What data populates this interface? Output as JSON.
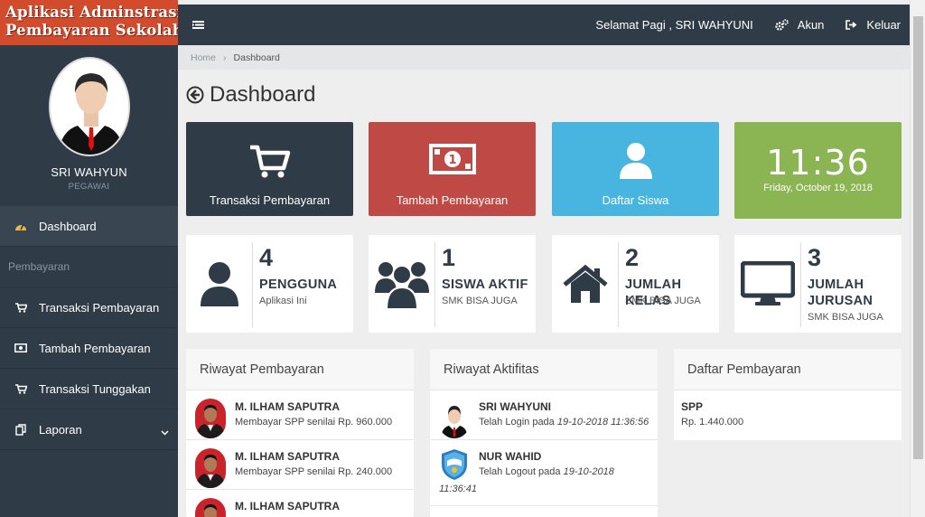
{
  "brand": {
    "line1": "Aplikasi Adminstrasi",
    "line2": "Pembayaran Sekolah"
  },
  "profile": {
    "name": "SRI WAHYUN",
    "role": "PEGAWAI"
  },
  "sidebar": {
    "dashboard": "Dashboard",
    "section": "Pembayaran",
    "items": [
      {
        "label": "Transaksi Pembayaran",
        "icon": "cart-icon"
      },
      {
        "label": "Tambah Pembayaran",
        "icon": "money-icon"
      },
      {
        "label": "Transaksi Tunggakan",
        "icon": "cart-icon"
      },
      {
        "label": "Laporan",
        "icon": "copy-icon"
      }
    ]
  },
  "topbar": {
    "greeting": "Selamat Pagi , SRI WAHYUNI",
    "account": "Akun",
    "logout": "Keluar"
  },
  "breadcrumb": {
    "home": "Home",
    "current": "Dashboard"
  },
  "page_title": "Dashboard",
  "tiles": {
    "t1": "Transaksi Pembayaran",
    "t2": "Tambah Pembayaran",
    "t3": "Daftar Siswa",
    "clock_time": "11:36",
    "clock_date": "Friday, October 19, 2018"
  },
  "stats": [
    {
      "num": "4",
      "title": "PENGGUNA",
      "sub": "Aplikasi Ini"
    },
    {
      "num": "1",
      "title": "SISWA AKTIF",
      "sub": "SMK BISA JUGA"
    },
    {
      "num": "2",
      "title": "JUMLAH KELAS",
      "sub": "SMK BISA JUGA"
    },
    {
      "num": "3",
      "title": "JUMLAH JURUSAN",
      "sub": "SMK BISA JUGA"
    }
  ],
  "riwayat_pembayaran": {
    "title": "Riwayat Pembayaran",
    "rows": [
      {
        "name": "M. ILHAM SAPUTRA",
        "text": "Membayar SPP senilai Rp. 960.000"
      },
      {
        "name": "M. ILHAM SAPUTRA",
        "text": "Membayar SPP senilai Rp. 240.000"
      },
      {
        "name": "M. ILHAM SAPUTRA",
        "text": ""
      }
    ]
  },
  "riwayat_aktifitas": {
    "title": "Riwayat Aktifitas",
    "rows": [
      {
        "name": "SRI WAHYUNI",
        "text": "Telah Login pada ",
        "time": "19-10-2018 11:36:56"
      },
      {
        "name": "NUR WAHID",
        "text": "Telah Logout pada ",
        "time": "19-10-2018",
        "time2": "11:36:41"
      }
    ]
  },
  "daftar_pembayaran": {
    "title": "Daftar Pembayaran",
    "rows": [
      {
        "name": "SPP",
        "text": "Rp. 1.440.000"
      }
    ]
  },
  "colors": {
    "sidebar": "#2f3b46",
    "brand": "#d24b2c",
    "red": "#bf4a45",
    "blue": "#48b5e1",
    "green": "#8bb552"
  }
}
